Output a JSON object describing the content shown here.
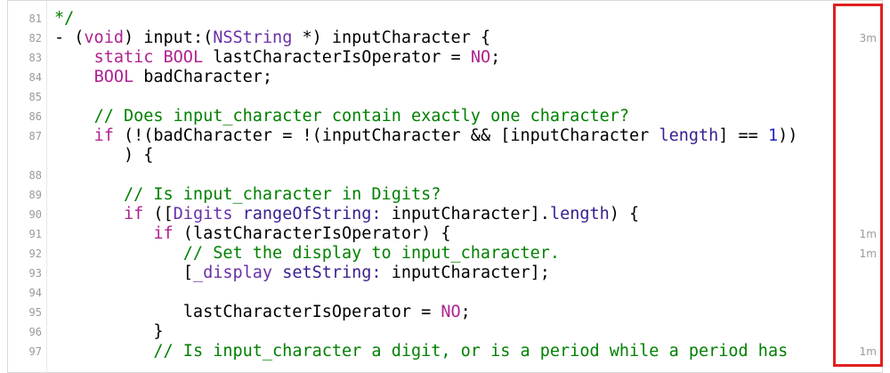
{
  "colors": {
    "plain": "#000000",
    "keyword": "#b0218f",
    "type": "#6a2fa8",
    "comment": "#008000",
    "method": "#3a1d8f",
    "number": "#1e1ec8",
    "line_number": "#9a9a9a",
    "highlight": "#e0201e"
  },
  "lines": [
    {
      "num": "81",
      "coverage": "",
      "tokens": [
        {
          "t": "*/",
          "c": "comment"
        }
      ]
    },
    {
      "num": "82",
      "coverage": "3m",
      "tokens": [
        {
          "t": "- (",
          "c": "plain"
        },
        {
          "t": "void",
          "c": "keyword"
        },
        {
          "t": ") input:(",
          "c": "plain"
        },
        {
          "t": "NSString",
          "c": "type"
        },
        {
          "t": " *) inputCharacter {",
          "c": "plain"
        }
      ]
    },
    {
      "num": "83",
      "coverage": "",
      "tokens": [
        {
          "t": "    ",
          "c": "plain"
        },
        {
          "t": "static",
          "c": "keyword"
        },
        {
          "t": " ",
          "c": "plain"
        },
        {
          "t": "BOOL",
          "c": "keyword"
        },
        {
          "t": " lastCharacterIsOperator = ",
          "c": "plain"
        },
        {
          "t": "NO",
          "c": "keyword"
        },
        {
          "t": ";",
          "c": "plain"
        }
      ]
    },
    {
      "num": "84",
      "coverage": "",
      "tokens": [
        {
          "t": "    ",
          "c": "plain"
        },
        {
          "t": "BOOL",
          "c": "keyword"
        },
        {
          "t": " badCharacter;",
          "c": "plain"
        }
      ]
    },
    {
      "num": "85",
      "coverage": "",
      "tokens": []
    },
    {
      "num": "86",
      "coverage": "",
      "tokens": [
        {
          "t": "    ",
          "c": "plain"
        },
        {
          "t": "// Does input_character contain exactly one character?",
          "c": "comment"
        }
      ]
    },
    {
      "num": "87",
      "coverage": "",
      "tokens": [
        {
          "t": "    ",
          "c": "plain"
        },
        {
          "t": "if",
          "c": "keyword"
        },
        {
          "t": " (!(badCharacter = !(inputCharacter && [inputCharacter ",
          "c": "plain"
        },
        {
          "t": "length",
          "c": "method"
        },
        {
          "t": "] == ",
          "c": "plain"
        },
        {
          "t": "1",
          "c": "number"
        },
        {
          "t": "))",
          "c": "plain"
        }
      ]
    },
    {
      "num": "",
      "coverage": "",
      "tokens": [
        {
          "t": "       ) {",
          "c": "plain"
        }
      ]
    },
    {
      "num": "88",
      "coverage": "",
      "tokens": []
    },
    {
      "num": "89",
      "coverage": "",
      "tokens": [
        {
          "t": "       ",
          "c": "plain"
        },
        {
          "t": "// Is input_character in Digits?",
          "c": "comment"
        }
      ]
    },
    {
      "num": "90",
      "coverage": "",
      "tokens": [
        {
          "t": "       ",
          "c": "plain"
        },
        {
          "t": "if",
          "c": "keyword"
        },
        {
          "t": " ([",
          "c": "plain"
        },
        {
          "t": "Digits",
          "c": "type"
        },
        {
          "t": " ",
          "c": "plain"
        },
        {
          "t": "rangeOfString:",
          "c": "method"
        },
        {
          "t": " inputCharacter].",
          "c": "plain"
        },
        {
          "t": "length",
          "c": "method"
        },
        {
          "t": ") {",
          "c": "plain"
        }
      ]
    },
    {
      "num": "91",
      "coverage": "1m",
      "tokens": [
        {
          "t": "          ",
          "c": "plain"
        },
        {
          "t": "if",
          "c": "keyword"
        },
        {
          "t": " (lastCharacterIsOperator) {",
          "c": "plain"
        }
      ]
    },
    {
      "num": "92",
      "coverage": "1m",
      "tokens": [
        {
          "t": "             ",
          "c": "plain"
        },
        {
          "t": "// Set the display to input_character.",
          "c": "comment"
        }
      ]
    },
    {
      "num": "93",
      "coverage": "",
      "tokens": [
        {
          "t": "             [",
          "c": "plain"
        },
        {
          "t": "_display",
          "c": "type"
        },
        {
          "t": " ",
          "c": "plain"
        },
        {
          "t": "setString:",
          "c": "method"
        },
        {
          "t": " inputCharacter];",
          "c": "plain"
        }
      ]
    },
    {
      "num": "94",
      "coverage": "",
      "tokens": []
    },
    {
      "num": "95",
      "coverage": "",
      "tokens": [
        {
          "t": "             lastCharacterIsOperator = ",
          "c": "plain"
        },
        {
          "t": "NO",
          "c": "keyword"
        },
        {
          "t": ";",
          "c": "plain"
        }
      ]
    },
    {
      "num": "96",
      "coverage": "",
      "tokens": [
        {
          "t": "          }",
          "c": "plain"
        }
      ]
    },
    {
      "num": "97",
      "coverage": "1m",
      "tokens": [
        {
          "t": "          ",
          "c": "plain"
        },
        {
          "t": "// Is input_character a digit, or is a period while a period has",
          "c": "comment"
        }
      ]
    }
  ]
}
